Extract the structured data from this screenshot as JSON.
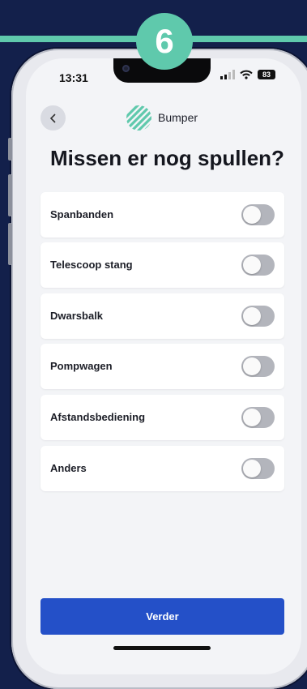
{
  "step": {
    "number": "6"
  },
  "status_bar": {
    "time": "13:31",
    "battery": "83"
  },
  "header": {
    "brand": "Bumper"
  },
  "page": {
    "title": "Missen er nog spullen?"
  },
  "items": [
    {
      "label": "Spanbanden",
      "on": false
    },
    {
      "label": "Telescoop stang",
      "on": false
    },
    {
      "label": "Dwarsbalk",
      "on": false
    },
    {
      "label": "Pompwagen",
      "on": false
    },
    {
      "label": "Afstandsbediening",
      "on": false
    },
    {
      "label": "Anders",
      "on": false
    }
  ],
  "actions": {
    "continue_label": "Verder"
  },
  "colors": {
    "accent": "#5fc9ac",
    "background": "#13204b",
    "button": "#2450c8",
    "toggle_off": "#b3b5bc"
  },
  "icons": {
    "back": "chevron-left-icon",
    "logo": "bumper-logo-icon",
    "signal": "signal-icon",
    "wifi": "wifi-icon",
    "battery": "battery-icon"
  }
}
